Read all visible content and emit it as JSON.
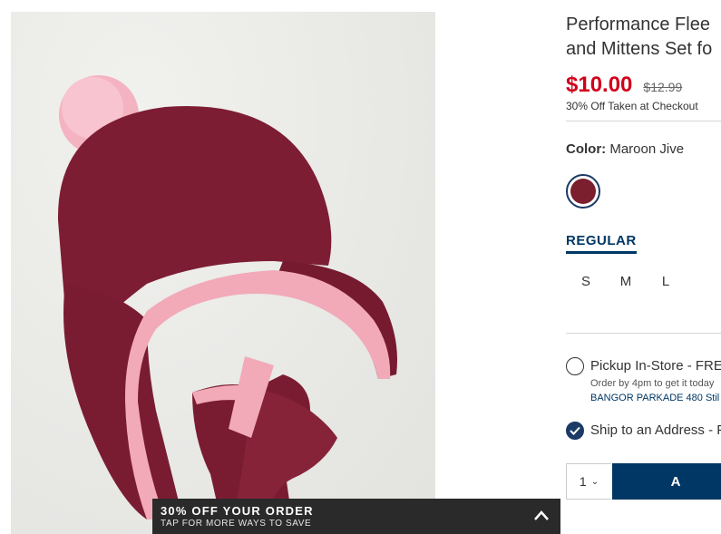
{
  "product": {
    "title_line1": "Performance Flee",
    "title_line2": "and Mittens Set fo",
    "sale_price": "$10.00",
    "original_price": "$12.99",
    "discount_note": "30% Off Taken at Checkout",
    "color_label": "Color:",
    "color_value": "Maroon Jive",
    "swatch_color": "#7b1e2e"
  },
  "fit": {
    "active_tab": "REGULAR"
  },
  "sizes": [
    "S",
    "M",
    "L"
  ],
  "fulfillment": {
    "pickup_label": "Pickup In-Store - FREE",
    "pickup_note": "Order by 4pm to get it today",
    "pickup_store": "BANGOR PARKADE 480 Stil",
    "ship_label": "Ship to an Address - F"
  },
  "cart": {
    "quantity": "1",
    "add_button": "A"
  },
  "promo": {
    "title": "30% OFF YOUR ORDER",
    "subtitle": "TAP FOR MORE WAYS TO SAVE"
  },
  "colors": {
    "accent_navy": "#003764",
    "sale_red": "#d0021b"
  }
}
